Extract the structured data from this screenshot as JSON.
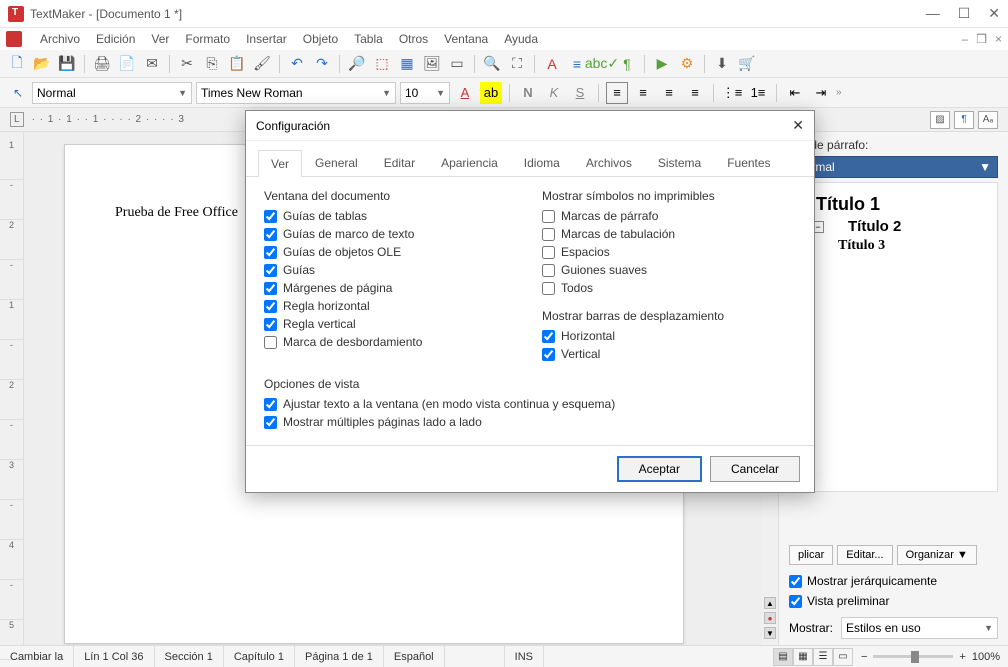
{
  "app": {
    "title": "TextMaker - [Documento 1 *]"
  },
  "menu": [
    "Archivo",
    "Edición",
    "Ver",
    "Formato",
    "Insertar",
    "Objeto",
    "Tabla",
    "Otros",
    "Ventana",
    "Ayuda"
  ],
  "fmt": {
    "style": "Normal",
    "font": "Times New Roman",
    "size": "10"
  },
  "ruler": "·  ·  1 · 1 ·  · 1 ·  ·  ·  ·  2 ·  ·  ·  ·  3",
  "doc_text": "Prueba de Free Office ",
  "side": {
    "label": "ilos de párrafo:",
    "current": "Normal",
    "titles": [
      "Título 1",
      "Título 2",
      "Título 3"
    ],
    "buttons": [
      "plicar",
      "Editar...",
      "Organizar"
    ],
    "hier": "Mostrar jerárquicamente",
    "prev": "Vista preliminar",
    "show": "Mostrar:",
    "showval": "Estilos en uso"
  },
  "status": {
    "cells": [
      "Cambiar la",
      "Lín 1 Col 36",
      "Sección 1",
      "Capítulo 1",
      "Página 1 de 1",
      "Español",
      "",
      "INS"
    ],
    "zoom": "100%"
  },
  "dialog": {
    "title": "Configuración",
    "tabs": [
      "Ver",
      "General",
      "Editar",
      "Apariencia",
      "Idioma",
      "Archivos",
      "Sistema",
      "Fuentes"
    ],
    "g1": {
      "title": "Ventana del documento",
      "opts": [
        {
          "label": "Guías de tablas",
          "checked": true,
          "u": "t"
        },
        {
          "label": "Guías de marco de texto",
          "checked": true,
          "u": "m"
        },
        {
          "label": "Guías de objetos OLE",
          "checked": true,
          "u": "O"
        },
        {
          "label": "Guías",
          "checked": true,
          "u": "G"
        },
        {
          "label": "Márgenes de página",
          "checked": true,
          "u": "M"
        },
        {
          "label": "Regla horizontal",
          "checked": true,
          "u": "h"
        },
        {
          "label": "Regla vertical",
          "checked": true,
          "u": "v"
        },
        {
          "label": "Marca de desbordamiento",
          "checked": false,
          "u": ""
        }
      ]
    },
    "g2": {
      "title": "Mostrar símbolos no imprimibles",
      "opts": [
        {
          "label": "Marcas de párrafo",
          "checked": false,
          "u": "p"
        },
        {
          "label": "Marcas de tabulación",
          "checked": false,
          "u": "t"
        },
        {
          "label": "Espacios",
          "checked": false,
          "u": "E"
        },
        {
          "label": "Guiones suaves",
          "checked": false,
          "u": "s"
        },
        {
          "label": "Todos",
          "checked": false,
          "u": "T"
        }
      ]
    },
    "g3": {
      "title": "Mostrar barras de desplazamiento",
      "opts": [
        {
          "label": "Horizontal",
          "checked": true,
          "u": "H"
        },
        {
          "label": "Vertical",
          "checked": true,
          "u": "V"
        }
      ]
    },
    "g4": {
      "title": "Opciones de vista",
      "opts": [
        {
          "label": "Ajustar texto a la ventana (en modo vista continua y esquema)",
          "checked": true,
          "u": "A"
        },
        {
          "label": "Mostrar múltiples páginas lado a lado",
          "checked": true,
          "u": "M"
        }
      ]
    },
    "ok": "Aceptar",
    "cancel": "Cancelar"
  }
}
